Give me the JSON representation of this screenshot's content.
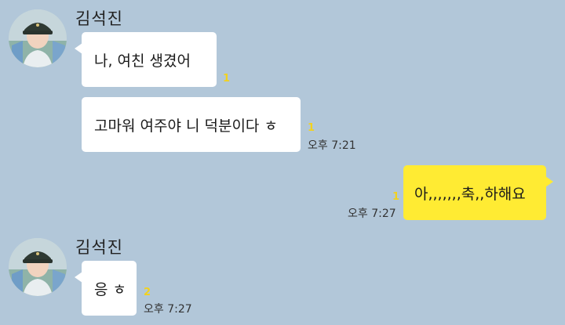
{
  "messages": [
    {
      "sender": "김석진",
      "text": "나, 여친 생겼어",
      "unread": "1",
      "time": ""
    },
    {
      "text": "고마워 여주야 니 덕분이다 ㅎ",
      "unread": "1",
      "time": "오후 7:21"
    },
    {
      "mine": true,
      "text": "아,,,,,,,축,,하해요",
      "unread": "1",
      "time": "오후 7:27"
    },
    {
      "sender": "김석진",
      "text": "응 ㅎ",
      "unread": "2",
      "time": "오후 7:27"
    }
  ],
  "colors": {
    "background": "#b2c7d9",
    "bubble_received": "#ffffff",
    "bubble_sent": "#ffeb33",
    "unread_count": "#f2d21e"
  },
  "icons": {
    "avatar": "profile-photo"
  }
}
